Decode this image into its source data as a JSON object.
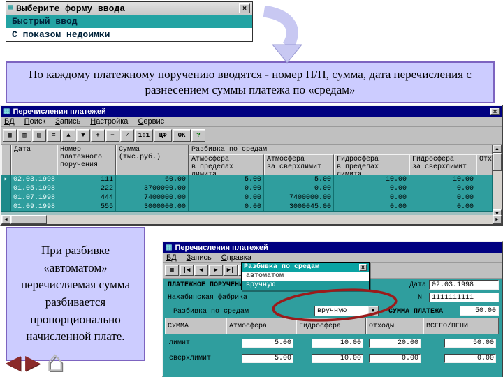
{
  "callouts": {
    "top": "По каждому платежному поручению вводятся - номер П/П, сумма, дата перечисления с разнесением суммы платежа по «средам»",
    "bottom": "При разбивке «автоматом» перечисляемая сумма разбивается пропорционально начисленной плате."
  },
  "form_dialog": {
    "title": "Выберите форму ввода",
    "close": "×",
    "items": [
      {
        "label": "Быстрый ввод"
      },
      {
        "label": "С показом недоимки"
      }
    ]
  },
  "main_window": {
    "icon": "▦",
    "title": "Перечисления платежей",
    "close": "×",
    "menu": [
      "БД",
      "Поиск",
      "Запись",
      "Настройка",
      "Сервис"
    ],
    "toolbar": [
      "▦",
      "▥",
      "▤",
      "≡",
      "▲",
      "▼",
      "+",
      "−",
      "✓",
      "1:1",
      "ЦФ",
      "OK",
      "?"
    ],
    "grid": {
      "row_marker": "▸",
      "col_date": "Дата",
      "col_number": "Номер\nплатежного\nпоручения",
      "col_sum": "Сумма\n(тыс.руб.)",
      "group_header": "Разбивка по средам",
      "subcols": [
        "Атмосфера\nв пределах лимита",
        "Атмосфера\nза сверхлимит",
        "Гидросфера\nв пределах лимита",
        "Гидросфера\nза сверхлимит",
        "Отх"
      ],
      "rows": [
        [
          "02.03.1998",
          "111",
          "60.00",
          "5.00",
          "5.00",
          "10.00",
          "10.00",
          ""
        ],
        [
          "01.05.1998",
          "222",
          "3700000.00",
          "0.00",
          "0.00",
          "0.00",
          "0.00",
          ""
        ],
        [
          "01.07.1998",
          "444",
          "7400000.00",
          "0.00",
          "7400000.00",
          "0.00",
          "0.00",
          ""
        ],
        [
          "01.09.1998",
          "555",
          "3000000.00",
          "0.00",
          "3000045.00",
          "0.00",
          "0.00",
          ""
        ]
      ]
    },
    "scroll": {
      "left": "◄",
      "right": "►",
      "up": "▲",
      "down": "▼"
    }
  },
  "detail_window": {
    "icon": "▦",
    "title": "Перечисления платежей",
    "menu": [
      "БД",
      "Запись",
      "Справка"
    ],
    "toolbar": [
      "▦",
      "|◀",
      "◀",
      "▶",
      "▶|",
      "+",
      "−",
      "✓",
      "?"
    ],
    "fields": {
      "order_label": "ПЛАТЕЖНОЕ ПОРУЧЕНИЕ",
      "date_label": "Дата",
      "date_value": "02.03.1998",
      "payer_value": "Нахабинская фабрика",
      "number_label": "N",
      "number_value": "1111111111",
      "split_label": "Разбивка по средам",
      "split_value": "вручную",
      "combo_arrow": "▼",
      "sum_label": "СУММА ПЛАТЕЖА",
      "sum_value": "50.00"
    },
    "dropdown": {
      "title": "Разбивка по средам",
      "close": "х",
      "options": [
        "автоматом",
        "вручную"
      ]
    },
    "breakdown": {
      "header": [
        "СУММА",
        "Атмосфера",
        "Гидросфера",
        "Отходы",
        "ВСЕГО/ПЕНИ"
      ],
      "rows": [
        {
          "label": "лимит",
          "values": [
            "5.00",
            "10.00",
            "20.00",
            "50.00"
          ]
        },
        {
          "label": "сверхлимит",
          "values": [
            "5.00",
            "10.00",
            "0.00",
            "0.00"
          ]
        }
      ]
    }
  },
  "nav": {
    "back": "◀",
    "forward": "▶",
    "home": "⌂"
  }
}
